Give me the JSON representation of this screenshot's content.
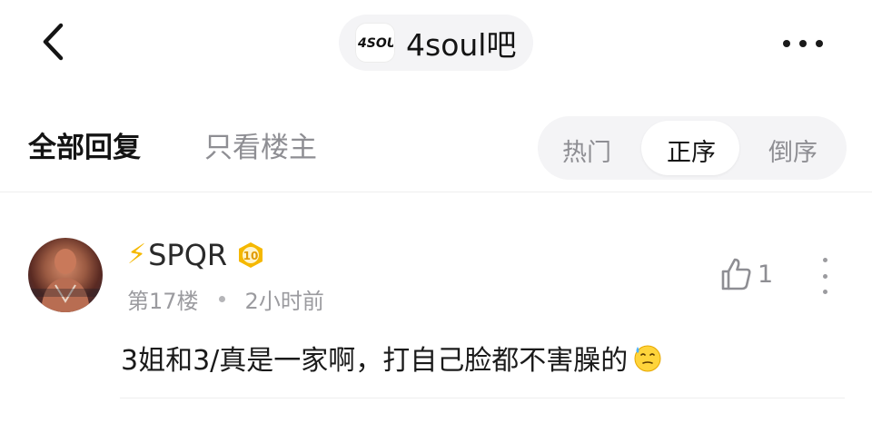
{
  "header": {
    "back_icon": "chevron-left-icon",
    "forum_logo_text": "4SOUL",
    "forum_name": "4soul吧",
    "more_icon": "more-horizontal-icon"
  },
  "filters": {
    "all_replies": "全部回复",
    "owner_only": "只看楼主",
    "sort_options": [
      "热门",
      "正序",
      "倒序"
    ],
    "sort_selected": "正序"
  },
  "post": {
    "prefix_icon": "lightning-icon",
    "username": "SPQR",
    "level": "10",
    "floor": "第17楼",
    "time": "2小时前",
    "like_count": "1",
    "content": "3姐和3/真是一家啊，打自己脸都不害臊的",
    "emoji": "sweat-smile-emoji"
  },
  "colors": {
    "primary_text": "#141414",
    "secondary_text": "#8e8e93",
    "pill_bg": "#f4f4f6",
    "bolt": "#f5b800",
    "badge": "#f5b800"
  }
}
